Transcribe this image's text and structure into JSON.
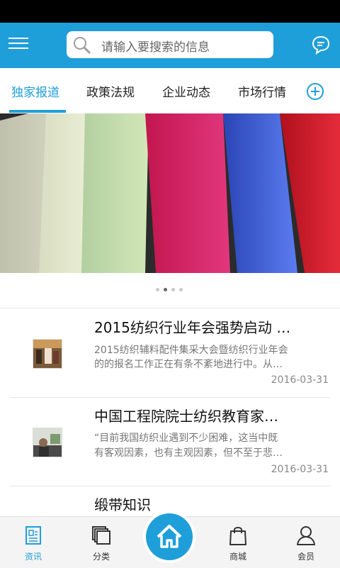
{
  "header": {
    "search_placeholder": "请输入要搜索的信息",
    "accent": "#1e9fd9"
  },
  "tabs": [
    {
      "label": "独家报道",
      "active": true
    },
    {
      "label": "政策法规",
      "active": false
    },
    {
      "label": "企业动态",
      "active": false
    },
    {
      "label": "市场行情",
      "active": false
    }
  ],
  "carousel": {
    "total_slides": 4,
    "active_index": 1
  },
  "news": [
    {
      "title": "2015纺织行业年会强势启动 …",
      "summary_line1": "2015纺织辅料配件集采大会暨纺织行业年会",
      "summary_line2": "的的报名工作正在有条不紊地进行中。从…",
      "date": "2016-03-31"
    },
    {
      "title": "中国工程院院士纺织教育家…",
      "summary_line1": "“目前我国纺织业遇到不少困难，这当中既",
      "summary_line2": "有客观因素，也有主观因素，但不至于悲…",
      "date": "2016-03-31"
    },
    {
      "title": "缎带知识"
    }
  ],
  "bottom_nav": [
    {
      "label": "资讯",
      "icon": "news-icon",
      "active": true
    },
    {
      "label": "分类",
      "icon": "category-icon",
      "active": false
    },
    {
      "label": "",
      "icon": "home-icon",
      "active": false
    },
    {
      "label": "商城",
      "icon": "shopping-bag-icon",
      "active": false
    },
    {
      "label": "会员",
      "icon": "user-icon",
      "active": false
    }
  ]
}
